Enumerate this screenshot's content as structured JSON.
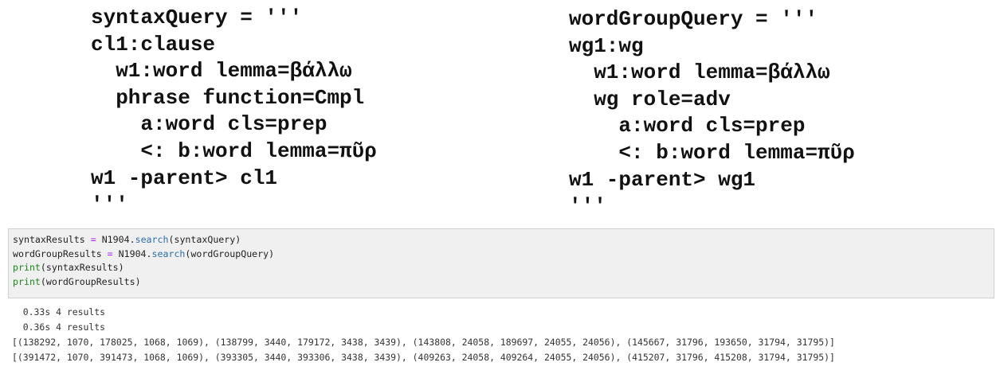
{
  "syntax_query": {
    "lines": [
      "syntaxQuery = '''",
      "cl1:clause",
      "  w1:word lemma=βάλλω",
      "  phrase function=Cmpl",
      "    a:word cls=prep",
      "    <: b:word lemma=πῦρ",
      "w1 -parent> cl1",
      "'''"
    ]
  },
  "wordgroup_query": {
    "lines": [
      "wordGroupQuery = '''",
      "wg1:wg",
      "  w1:word lemma=βάλλω",
      "  wg role=adv",
      "    a:word cls=prep",
      "    <: b:word lemma=πῦρ",
      "w1 -parent> wg1",
      "'''"
    ]
  },
  "code_cell": {
    "line1": {
      "var": "syntaxResults ",
      "op": "=",
      "obj": " N1904.",
      "method": "search",
      "args": "(syntaxQuery)"
    },
    "line2": {
      "var": "wordGroupResults ",
      "op": "=",
      "obj": " N1904.",
      "method": "search",
      "args": "(wordGroupQuery)"
    },
    "line3": {
      "builtin": "print",
      "args": "(syntaxResults)"
    },
    "line4": {
      "builtin": "print",
      "args": "(wordGroupResults)"
    }
  },
  "output": {
    "lines": [
      "  0.33s 4 results",
      "  0.36s 4 results",
      "[(138292, 1070, 178025, 1068, 1069), (138799, 3440, 179172, 3438, 3439), (143808, 24058, 189697, 24055, 24056), (145667, 31796, 193650, 31794, 31795)]",
      "[(391472, 1070, 391473, 1068, 1069), (393305, 3440, 393306, 3438, 3439), (409263, 24058, 409264, 24055, 24056), (415207, 31796, 415208, 31794, 31795)]"
    ]
  }
}
